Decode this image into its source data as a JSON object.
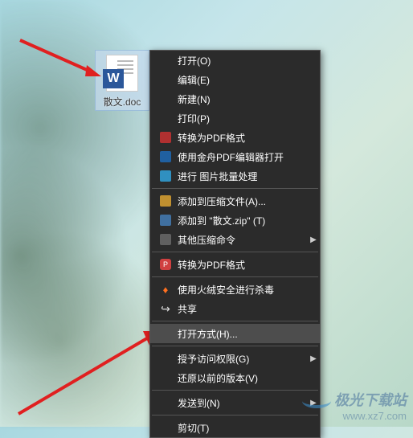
{
  "file": {
    "label": "散文.doc",
    "badge": "W"
  },
  "menu": {
    "items": [
      {
        "label": "打开(O)",
        "icon": "",
        "hasSubmenu": false
      },
      {
        "label": "编辑(E)",
        "icon": "",
        "hasSubmenu": false
      },
      {
        "label": "新建(N)",
        "icon": "",
        "hasSubmenu": false
      },
      {
        "label": "打印(P)",
        "icon": "",
        "hasSubmenu": false
      },
      {
        "label": "转换为PDF格式",
        "icon": "pdf",
        "hasSubmenu": false
      },
      {
        "label": "使用金舟PDF编辑器打开",
        "icon": "pdf2",
        "hasSubmenu": false
      },
      {
        "label": "进行 图片批量处理",
        "icon": "img",
        "hasSubmenu": false
      },
      {
        "type": "separator"
      },
      {
        "label": "添加到压缩文件(A)...",
        "icon": "zip",
        "hasSubmenu": false
      },
      {
        "label": "添加到 \"散文.zip\" (T)",
        "icon": "zip2",
        "hasSubmenu": false
      },
      {
        "label": "其他压缩命令",
        "icon": "cmd",
        "hasSubmenu": true
      },
      {
        "type": "separator"
      },
      {
        "label": "转换为PDF格式",
        "icon": "pdf3",
        "hasSubmenu": false
      },
      {
        "type": "separator"
      },
      {
        "label": "使用火绒安全进行杀毒",
        "icon": "fire",
        "hasSubmenu": false
      },
      {
        "label": "共享",
        "icon": "share",
        "hasSubmenu": false
      },
      {
        "type": "separator"
      },
      {
        "label": "打开方式(H)...",
        "icon": "",
        "hasSubmenu": false,
        "highlighted": true
      },
      {
        "type": "separator"
      },
      {
        "label": "授予访问权限(G)",
        "icon": "",
        "hasSubmenu": true
      },
      {
        "label": "还原以前的版本(V)",
        "icon": "",
        "hasSubmenu": false
      },
      {
        "type": "separator"
      },
      {
        "label": "发送到(N)",
        "icon": "",
        "hasSubmenu": true
      },
      {
        "type": "separator"
      },
      {
        "label": "剪切(T)",
        "icon": "",
        "hasSubmenu": false
      }
    ]
  },
  "watermark": {
    "title": "极光下载站",
    "url": "www.xz7.com"
  }
}
